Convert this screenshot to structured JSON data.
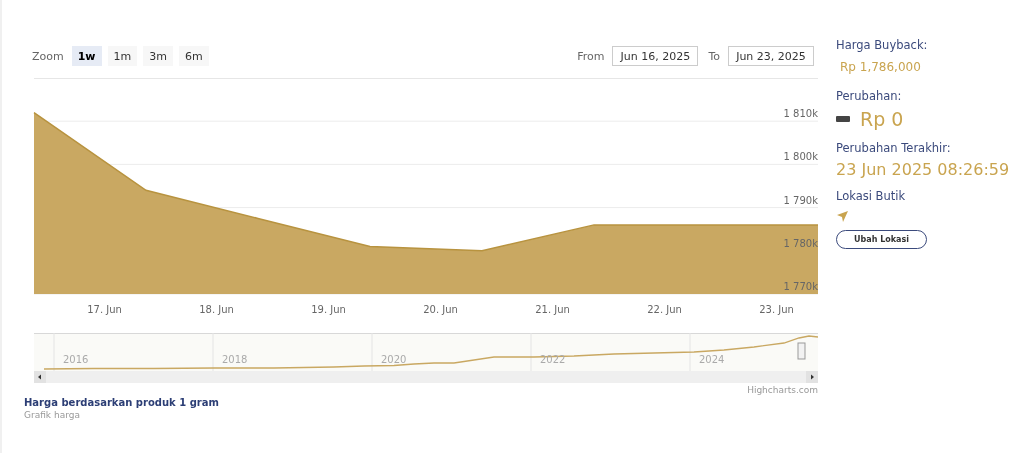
{
  "zoom": {
    "label": "Zoom",
    "buttons": [
      {
        "label": "1w",
        "selected": true
      },
      {
        "label": "1m",
        "selected": false
      },
      {
        "label": "3m",
        "selected": false
      },
      {
        "label": "6m",
        "selected": false
      }
    ]
  },
  "range": {
    "from_label": "From",
    "from_value": "Jun 16, 2025",
    "to_label": "To",
    "to_value": "Jun 23, 2025"
  },
  "chart": {
    "chart_data": {
      "type": "area",
      "categories": [
        null,
        "17. Jun",
        "18. Jun",
        "19. Jun",
        "20. Jun",
        "21. Jun",
        "22. Jun",
        "23. Jun"
      ],
      "series": [
        {
          "color": "#c9a862",
          "values": [
            1812,
            1794,
            1787.5,
            1781,
            1780,
            1786,
            1786,
            1786
          ]
        }
      ],
      "ylim": [
        1770,
        1820
      ],
      "grid": true,
      "yticks": [
        {
          "value": 1770,
          "label": "1 770k"
        },
        {
          "value": 1780,
          "label": "1 780k"
        },
        {
          "value": 1790,
          "label": "1 790k"
        },
        {
          "value": 1800,
          "label": "1 800k"
        },
        {
          "value": 1810,
          "label": "1 810k"
        }
      ]
    }
  },
  "navigator": {
    "years": [
      "2016",
      "2018",
      "2020",
      "2022",
      "2024"
    ]
  },
  "credit": "Highcharts.com",
  "caption": {
    "title": "Harga berdasarkan produk 1 gram",
    "subtitle": "Grafik harga"
  },
  "panel": {
    "buyback_label": "Harga Buyback:",
    "buyback_value": "Rp 1,786,000",
    "change_label": "Perubahan:",
    "change_value": "Rp 0",
    "last_label": "Perubahan Terakhir:",
    "last_value": "23 Jun 2025 08:26:59",
    "location_label": "Lokasi Butik",
    "location_button": "Ubah Lokasi"
  }
}
